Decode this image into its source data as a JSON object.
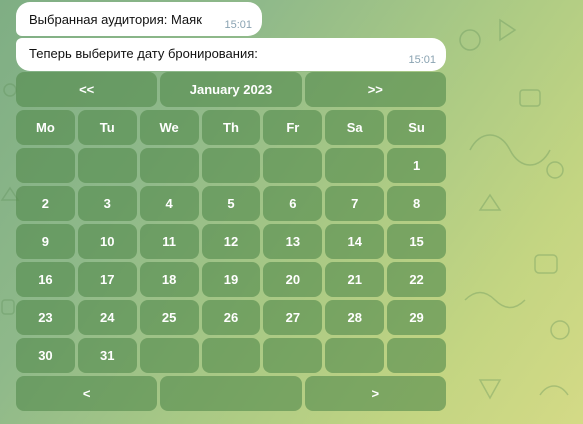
{
  "messages": [
    {
      "text": "Выбранная аудитория: Маяк",
      "time": "15:01"
    },
    {
      "text": "Теперь выберите дату бронирования:",
      "time": "15:01"
    }
  ],
  "keyboard": {
    "nav_top": {
      "prev": "<<",
      "month": "January 2023",
      "next": ">>"
    },
    "weekdays": [
      "Mo",
      "Tu",
      "We",
      "Th",
      "Fr",
      "Sa",
      "Su"
    ],
    "weeks": [
      [
        "",
        "",
        "",
        "",
        "",
        "",
        "1"
      ],
      [
        "2",
        "3",
        "4",
        "5",
        "6",
        "7",
        "8"
      ],
      [
        "9",
        "10",
        "11",
        "12",
        "13",
        "14",
        "15"
      ],
      [
        "16",
        "17",
        "18",
        "19",
        "20",
        "21",
        "22"
      ],
      [
        "23",
        "24",
        "25",
        "26",
        "27",
        "28",
        "29"
      ],
      [
        "30",
        "31",
        "",
        "",
        "",
        "",
        ""
      ]
    ],
    "nav_bottom": {
      "prev": "<",
      "middle": "",
      "next": ">"
    }
  },
  "colors": {
    "button_bg": "#5a8f52",
    "bubble_bg": "#ffffff",
    "time_text": "#8aa3b2"
  }
}
